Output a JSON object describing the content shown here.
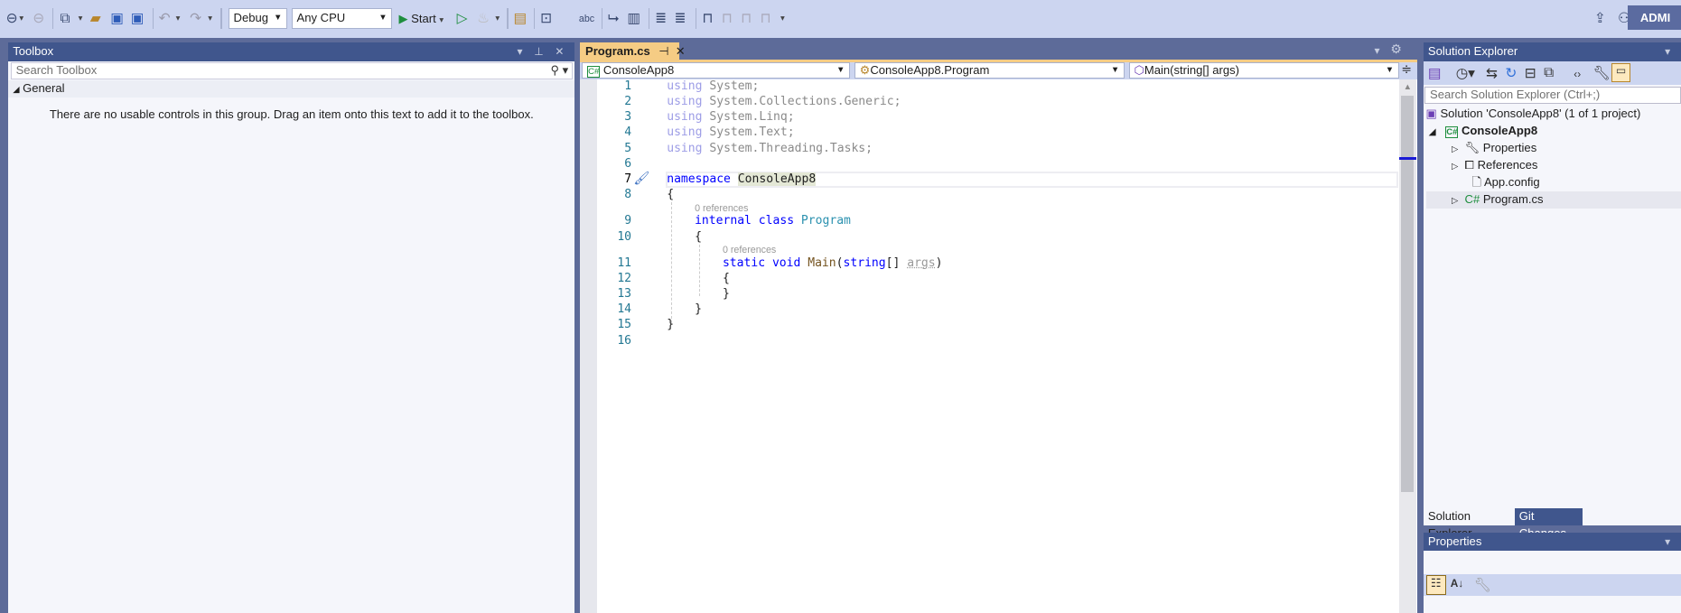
{
  "toolbar": {
    "config": "Debug",
    "platform": "Any CPU",
    "start": "Start",
    "user": "ADMI",
    "icons": [
      "back-icon",
      "forward-icon",
      "new-project-icon",
      "open-icon",
      "save-icon",
      "save-all-icon",
      "undo-icon",
      "redo-icon"
    ]
  },
  "toolbox": {
    "title": "Toolbox",
    "search_placeholder": "Search Toolbox",
    "group": "General",
    "empty_message": "There are no usable controls in this group. Drag an item onto this text to add it to the toolbox."
  },
  "editor": {
    "tab": "Program.cs",
    "nav": {
      "project": "ConsoleApp8",
      "type": "ConsoleApp8.Program",
      "member": "Main(string[] args)"
    },
    "lens": "0 references",
    "lines": {
      "l1a": "using",
      "l1b": " System;",
      "l2b": " System.Collections.Generic;",
      "l3b": " System.Linq;",
      "l4b": " System.Text;",
      "l5b": " System.Threading.Tasks;",
      "ns": "namespace",
      "nsname": "ConsoleApp8",
      "ob": "{",
      "cb": "}",
      "internal": "internal",
      "class": "class",
      "prog": "Program",
      "static": "static",
      "void": "void",
      "main": "Main",
      "paren": "(",
      "string": "string",
      "arr": "[] ",
      "args": "args",
      "cparen": ")"
    },
    "line_numbers": [
      "1",
      "2",
      "3",
      "4",
      "5",
      "6",
      "7",
      "8",
      "9",
      "10",
      "11",
      "12",
      "13",
      "14",
      "15",
      "16"
    ]
  },
  "solution_explorer": {
    "title": "Solution Explorer",
    "search_placeholder": "Search Solution Explorer (Ctrl+;)",
    "items": [
      {
        "label": "Solution 'ConsoleApp8' (1 of 1 project)"
      },
      {
        "label": "ConsoleApp8"
      },
      {
        "label": "Properties"
      },
      {
        "label": "References"
      },
      {
        "label": "App.config"
      },
      {
        "label": "Program.cs"
      }
    ],
    "tabs": [
      "Solution Explorer",
      "Git Changes"
    ]
  },
  "properties": {
    "title": "Properties"
  }
}
